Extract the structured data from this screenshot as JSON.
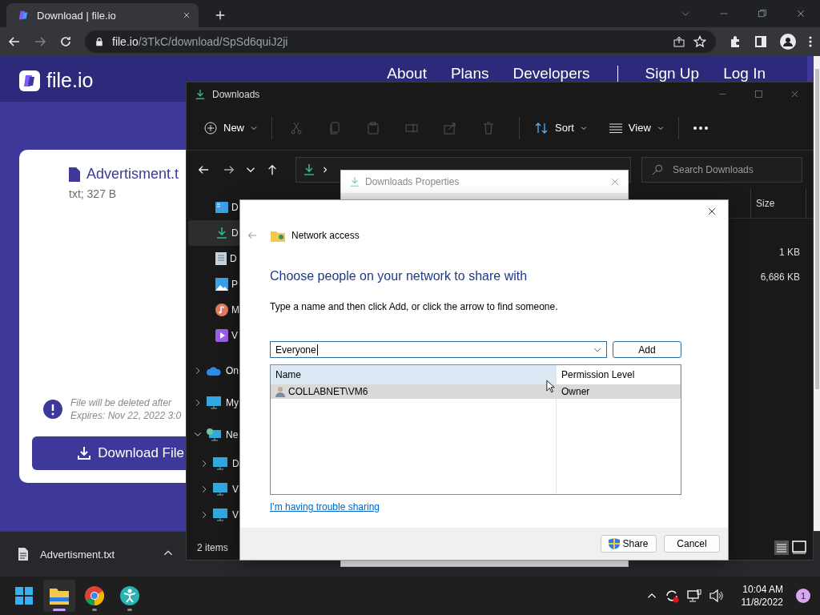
{
  "browser": {
    "tab": {
      "title": "Download | file.io"
    },
    "url": {
      "host": "file.io",
      "path": "/3TkC/download/SpSd6quiJ2ji"
    }
  },
  "site": {
    "logo": "file.io",
    "nav": [
      "About",
      "Plans",
      "Developers",
      "Sign Up",
      "Log In"
    ],
    "card": {
      "file_name": "Advertisment.t",
      "file_meta": "txt; 327 B",
      "notice": [
        "File will be deleted after",
        "Expires: Nov 22, 2022 3:0"
      ],
      "download_button": "Download File"
    }
  },
  "download_bar": {
    "file": "Advertisment.txt"
  },
  "explorer": {
    "title": "Downloads",
    "toolbar": {
      "new": "New",
      "sort": "Sort",
      "view": "View"
    },
    "search": {
      "placeholder": "Search Downloads"
    },
    "nav_pane": [
      {
        "kind": "desktop",
        "label": "D",
        "selected": false
      },
      {
        "kind": "downloads",
        "label": "D",
        "selected": true
      },
      {
        "kind": "documents",
        "label": "D",
        "selected": false
      },
      {
        "kind": "pictures",
        "label": "P",
        "selected": false
      },
      {
        "kind": "music",
        "label": "M",
        "selected": false
      },
      {
        "kind": "videos",
        "label": "V",
        "selected": false
      }
    ],
    "tree": [
      {
        "kind": "cloud",
        "label": "On",
        "expanded": false
      },
      {
        "kind": "computer",
        "label": "My",
        "expanded": false
      },
      {
        "kind": "network",
        "label": "Ne",
        "expanded": true,
        "children": [
          {
            "kind": "computer",
            "label": "D",
            "expanded": false
          },
          {
            "kind": "computer",
            "label": "V",
            "expanded": false
          },
          {
            "kind": "computer",
            "label": "V",
            "expanded": false
          }
        ]
      }
    ],
    "columns": [
      "Size"
    ],
    "sizes": [
      "1 KB",
      "6,686 KB"
    ],
    "status": "2 items"
  },
  "properties": {
    "title": "Downloads Properties"
  },
  "share_dialog": {
    "header": "Network access",
    "heading": "Choose people on your network to share with",
    "instruction": "Type a name and then click Add, or click the arrow to find someone.",
    "input": {
      "value": "Everyone"
    },
    "add_button": "Add",
    "columns": [
      "Name",
      "Permission Level"
    ],
    "rows": [
      {
        "name": "COLLABNET\\VM6",
        "permission": "Owner",
        "selected": true
      }
    ],
    "link": "I'm having trouble sharing",
    "buttons": {
      "share": "Share",
      "cancel": "Cancel"
    }
  },
  "taskbar": {
    "apps": [
      {
        "kind": "start",
        "active": false,
        "running": false
      },
      {
        "kind": "explorer",
        "active": true,
        "running": true
      },
      {
        "kind": "chrome",
        "active": false,
        "running": true
      },
      {
        "kind": "accessibility",
        "active": false,
        "running": true
      }
    ],
    "time": "10:04 AM",
    "date": "11/8/2022",
    "notifications": "1"
  }
}
